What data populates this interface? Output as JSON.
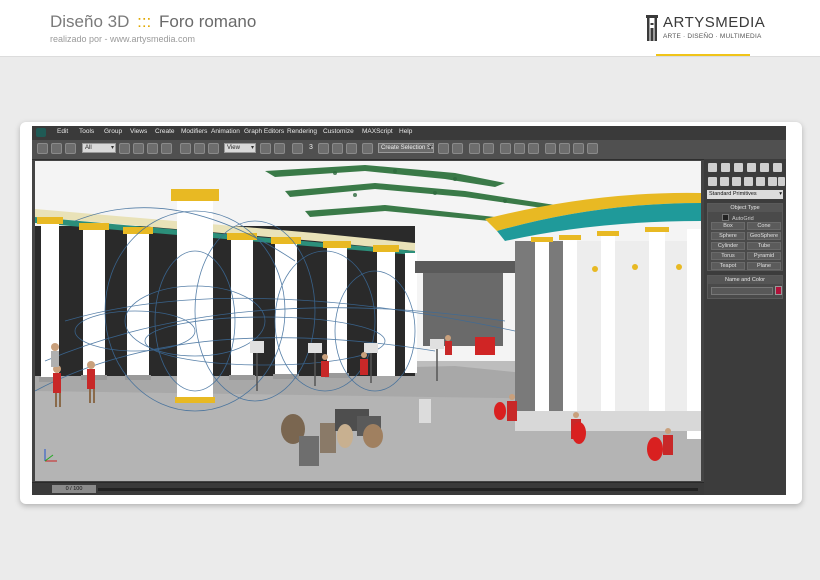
{
  "header": {
    "brand": "Diseño 3D",
    "separator": ":::",
    "project": "Foro romano",
    "credit": "realizado por - www.artysmedia.com",
    "logo_name": "ARTYSMEDIA",
    "logo_tagline": "ARTE · DISEÑO · MULTIMEDIA",
    "accent_color": "#f0c419"
  },
  "menu": [
    "Edit",
    "Tools",
    "Group",
    "Views",
    "Create",
    "Modifiers",
    "Animation",
    "Graph Editors",
    "Rendering",
    "Customize",
    "MAXScript",
    "Help"
  ],
  "toolbar": {
    "filter_value": "All",
    "refcoord_value": "View",
    "snap_value": "3",
    "selection_set_placeholder": "Create Selection Se"
  },
  "viewport": {
    "label": "",
    "scene_colors": {
      "sky": "#f7f7f7",
      "floor": "#b4b4b4",
      "column": "#ffffff",
      "wall": "#2b2b2b",
      "gold": "#e8b923",
      "teal": "#1f8e8e",
      "red": "#cc2a2a"
    }
  },
  "command_panel": {
    "creation_category": "Standard Primitives",
    "object_type_title": "Object Type",
    "autogrid_label": "AutoGrid",
    "primitives": [
      "Box",
      "Cone",
      "Sphere",
      "GeoSphere",
      "Cylinder",
      "Tube",
      "Torus",
      "Pyramid",
      "Teapot",
      "Plane"
    ],
    "name_color_title": "Name and Color",
    "object_color": "#b0123a"
  },
  "timeline": {
    "frame_label": "0 / 100"
  }
}
